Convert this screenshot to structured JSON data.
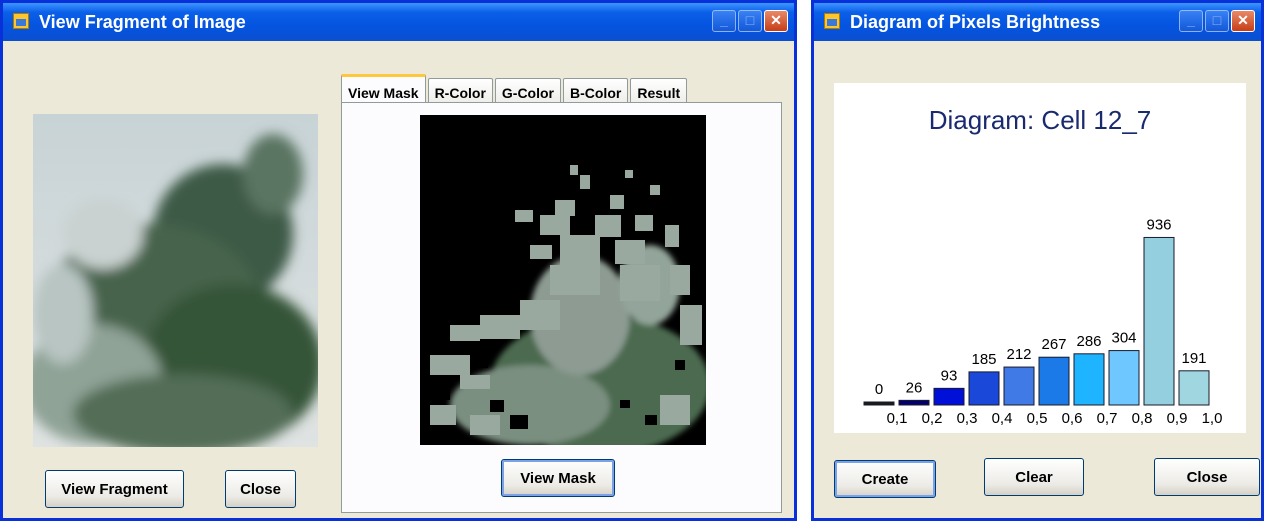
{
  "window_left": {
    "title": "View Fragment of Image",
    "tabs": [
      "View Mask",
      "R-Color",
      "G-Color",
      "B-Color",
      "Result"
    ],
    "view_fragment_label": "View Fragment",
    "close_label": "Close",
    "view_mask_label": "View Mask"
  },
  "window_right": {
    "title": "Diagram of Pixels Brightness",
    "create_label": "Create",
    "clear_label": "Clear",
    "close_label": "Close"
  },
  "chart_data": {
    "type": "bar",
    "title": "Diagram: Cell 12_7",
    "categories": [
      "0,1",
      "0,2",
      "0,3",
      "0,4",
      "0,5",
      "0,6",
      "0,7",
      "0,8",
      "0,9",
      "1,0"
    ],
    "values": [
      0,
      26,
      93,
      185,
      212,
      267,
      286,
      304,
      936,
      191
    ],
    "bar_colors": [
      "#1a1a1a",
      "#00006e",
      "#0010d8",
      "#1a48d8",
      "#3f7ae6",
      "#1c7ae8",
      "#1eb4ff",
      "#6ec8ff",
      "#94cfe0",
      "#9fd6e0"
    ],
    "xlabel": "",
    "ylabel": "",
    "ylim": [
      0,
      1000
    ],
    "grid": false,
    "legend": "none"
  }
}
